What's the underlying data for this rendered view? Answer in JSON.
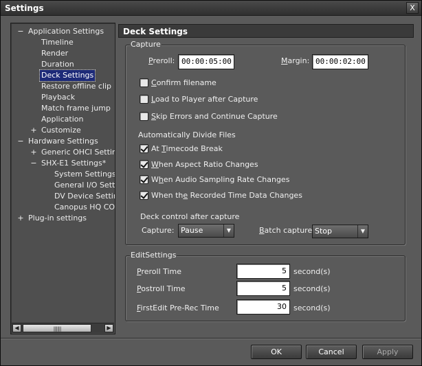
{
  "window": {
    "title": "Settings",
    "close_label": "X"
  },
  "tree": {
    "nodes": [
      {
        "label": "Application Settings",
        "expander": "−"
      },
      {
        "label": "Timeline"
      },
      {
        "label": "Render"
      },
      {
        "label": "Duration"
      },
      {
        "label": "Deck Settings",
        "selected": true
      },
      {
        "label": "Restore offline clip"
      },
      {
        "label": "Playback"
      },
      {
        "label": "Match frame jump"
      },
      {
        "label": "Application"
      },
      {
        "label": "Customize",
        "expander": "+"
      },
      {
        "label": "Hardware Settings",
        "expander": "−"
      },
      {
        "label": "Generic OHCI Settings",
        "expander": "+"
      },
      {
        "label": "SHX-E1 Settings*",
        "expander": "−"
      },
      {
        "label": "System Settings"
      },
      {
        "label": "General I/O Settings"
      },
      {
        "label": "DV Device Settings"
      },
      {
        "label": "Canopus HQ CODEC"
      },
      {
        "label": "Plug-in settings",
        "expander": "+"
      }
    ],
    "scroll_left": "◀",
    "scroll_right": "▶",
    "grip": "||||||||"
  },
  "panel": {
    "title": "Deck Settings"
  },
  "capture": {
    "legend": "Capture",
    "preroll": {
      "label_u": "P",
      "label_rest": "reroll:",
      "value": "00:00:05:00"
    },
    "margin": {
      "label_u": "M",
      "label_rest": "argin:",
      "value": "00:00:02:00"
    },
    "options": [
      {
        "u": "C",
        "rest": "onfirm filename",
        "checked": false
      },
      {
        "u": "L",
        "rest": "oad to Player after Capture",
        "checked": false
      },
      {
        "u": "S",
        "rest": "kip Errors and Continue Capture",
        "checked": false
      }
    ],
    "divide_label": "Automatically Divide Files",
    "divide_options": [
      {
        "pre": "At ",
        "u": "T",
        "rest": "imecode Break",
        "checked": true
      },
      {
        "pre": "",
        "u": "W",
        "rest": "hen Aspect Ratio Changes",
        "checked": true
      },
      {
        "pre": "W",
        "u": "h",
        "rest": "en Audio Sampling Rate Changes",
        "checked": true
      },
      {
        "pre": "When th",
        "u": "e",
        "rest": " Recorded Time Data Changes",
        "checked": true
      }
    ],
    "deck_control_label": "Deck control after capture",
    "capture_select": {
      "label": "Capture:",
      "value": "Pause"
    },
    "batch_select": {
      "label_u": "B",
      "label_rest": "atch capture:",
      "value": "Stop"
    },
    "arrow": "▼"
  },
  "edit": {
    "legend": "EditSettings",
    "unit": "second(s)",
    "rows": [
      {
        "u": "P",
        "rest": "reroll Time",
        "value": "5"
      },
      {
        "u": "P",
        "rest": "ostroll Time",
        "value": "5"
      },
      {
        "u": "F",
        "rest": "irstEdit Pre-Rec Time",
        "value": "30"
      }
    ]
  },
  "buttons": {
    "ok": "OK",
    "cancel": "Cancel",
    "apply": "Apply"
  }
}
